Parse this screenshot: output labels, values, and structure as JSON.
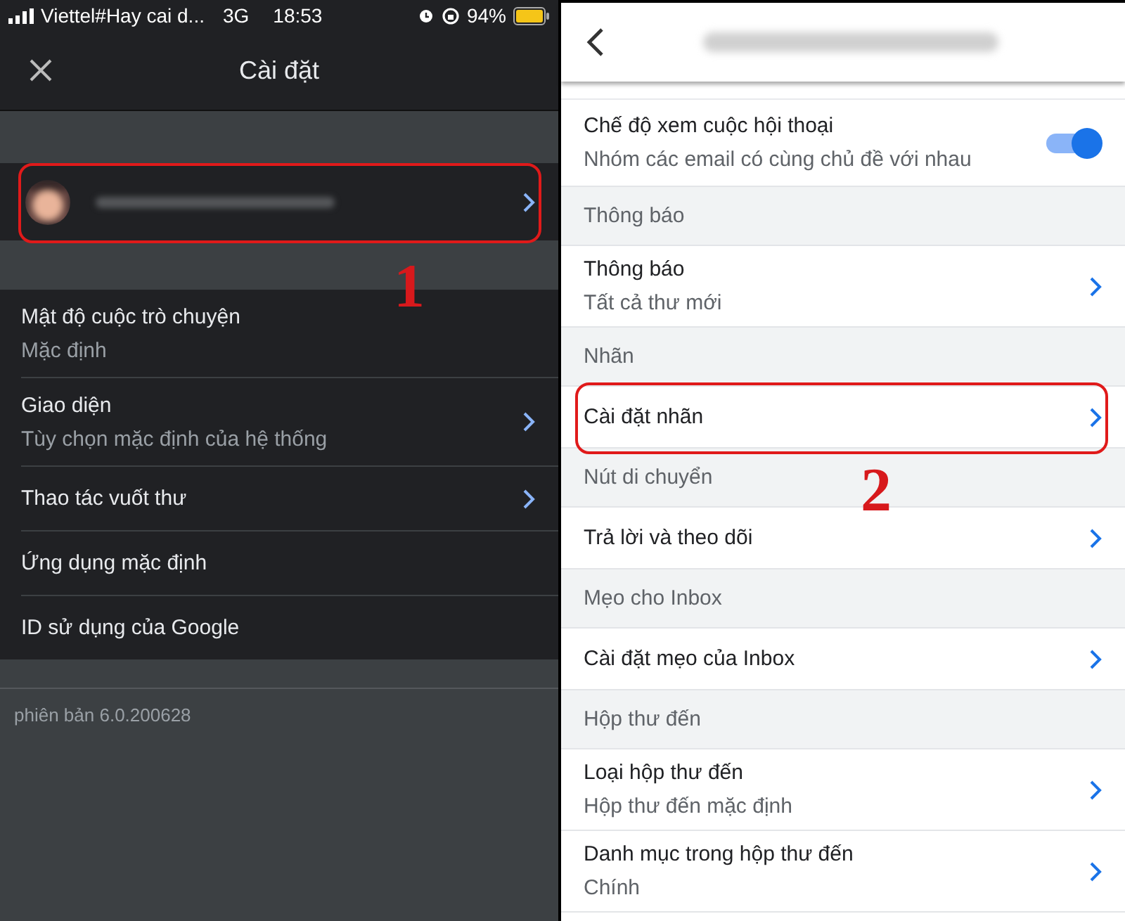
{
  "left_screen": {
    "status_bar": {
      "carrier": "Viettel#Hay cai d...",
      "network": "3G",
      "time": "18:53",
      "battery": "94%"
    },
    "title": "Cài đặt",
    "account": {
      "highlighted": true,
      "callout": "1"
    },
    "items": [
      {
        "title": "Mật độ cuộc trò chuyện",
        "subtitle": "Mặc định",
        "chevron": false
      },
      {
        "title": "Giao diện",
        "subtitle": "Tùy chọn mặc định của hệ thống",
        "chevron": true
      },
      {
        "title": "Thao tác vuốt thư",
        "chevron": true
      },
      {
        "title": "Ứng dụng mặc định",
        "chevron": false
      },
      {
        "title": "ID sử dụng của Google",
        "chevron": false
      }
    ],
    "version": "phiên bản 6.0.200628"
  },
  "right_screen": {
    "items": [
      {
        "kind": "toggle",
        "title": "Chế độ xem cuộc hội thoại",
        "subtitle": "Nhóm các email có cùng chủ đề với nhau",
        "on": true,
        "highlighted": false
      },
      {
        "kind": "section",
        "title": "Thông báo",
        "highlighted": false
      },
      {
        "kind": "row",
        "title": "Thông báo",
        "subtitle": "Tất cả thư mới",
        "highlighted": false
      },
      {
        "kind": "section",
        "title": "Nhãn",
        "highlighted": false
      },
      {
        "kind": "row",
        "title": "Cài đặt nhãn",
        "highlighted": true,
        "callout": "2"
      },
      {
        "kind": "section",
        "title": "Nút di chuyển",
        "highlighted": false
      },
      {
        "kind": "row",
        "title": "Trả lời và theo dõi",
        "highlighted": false
      },
      {
        "kind": "section",
        "title": "Mẹo cho Inbox",
        "highlighted": false
      },
      {
        "kind": "row",
        "title": "Cài đặt mẹo của Inbox",
        "highlighted": false
      },
      {
        "kind": "section",
        "title": "Hộp thư đến",
        "highlighted": false
      },
      {
        "kind": "row",
        "title": "Loại hộp thư đến",
        "subtitle": "Hộp thư đến mặc định",
        "highlighted": false
      },
      {
        "kind": "row",
        "title": "Danh mục trong hộp thư đến",
        "subtitle": "Chính",
        "highlighted": false
      }
    ]
  }
}
